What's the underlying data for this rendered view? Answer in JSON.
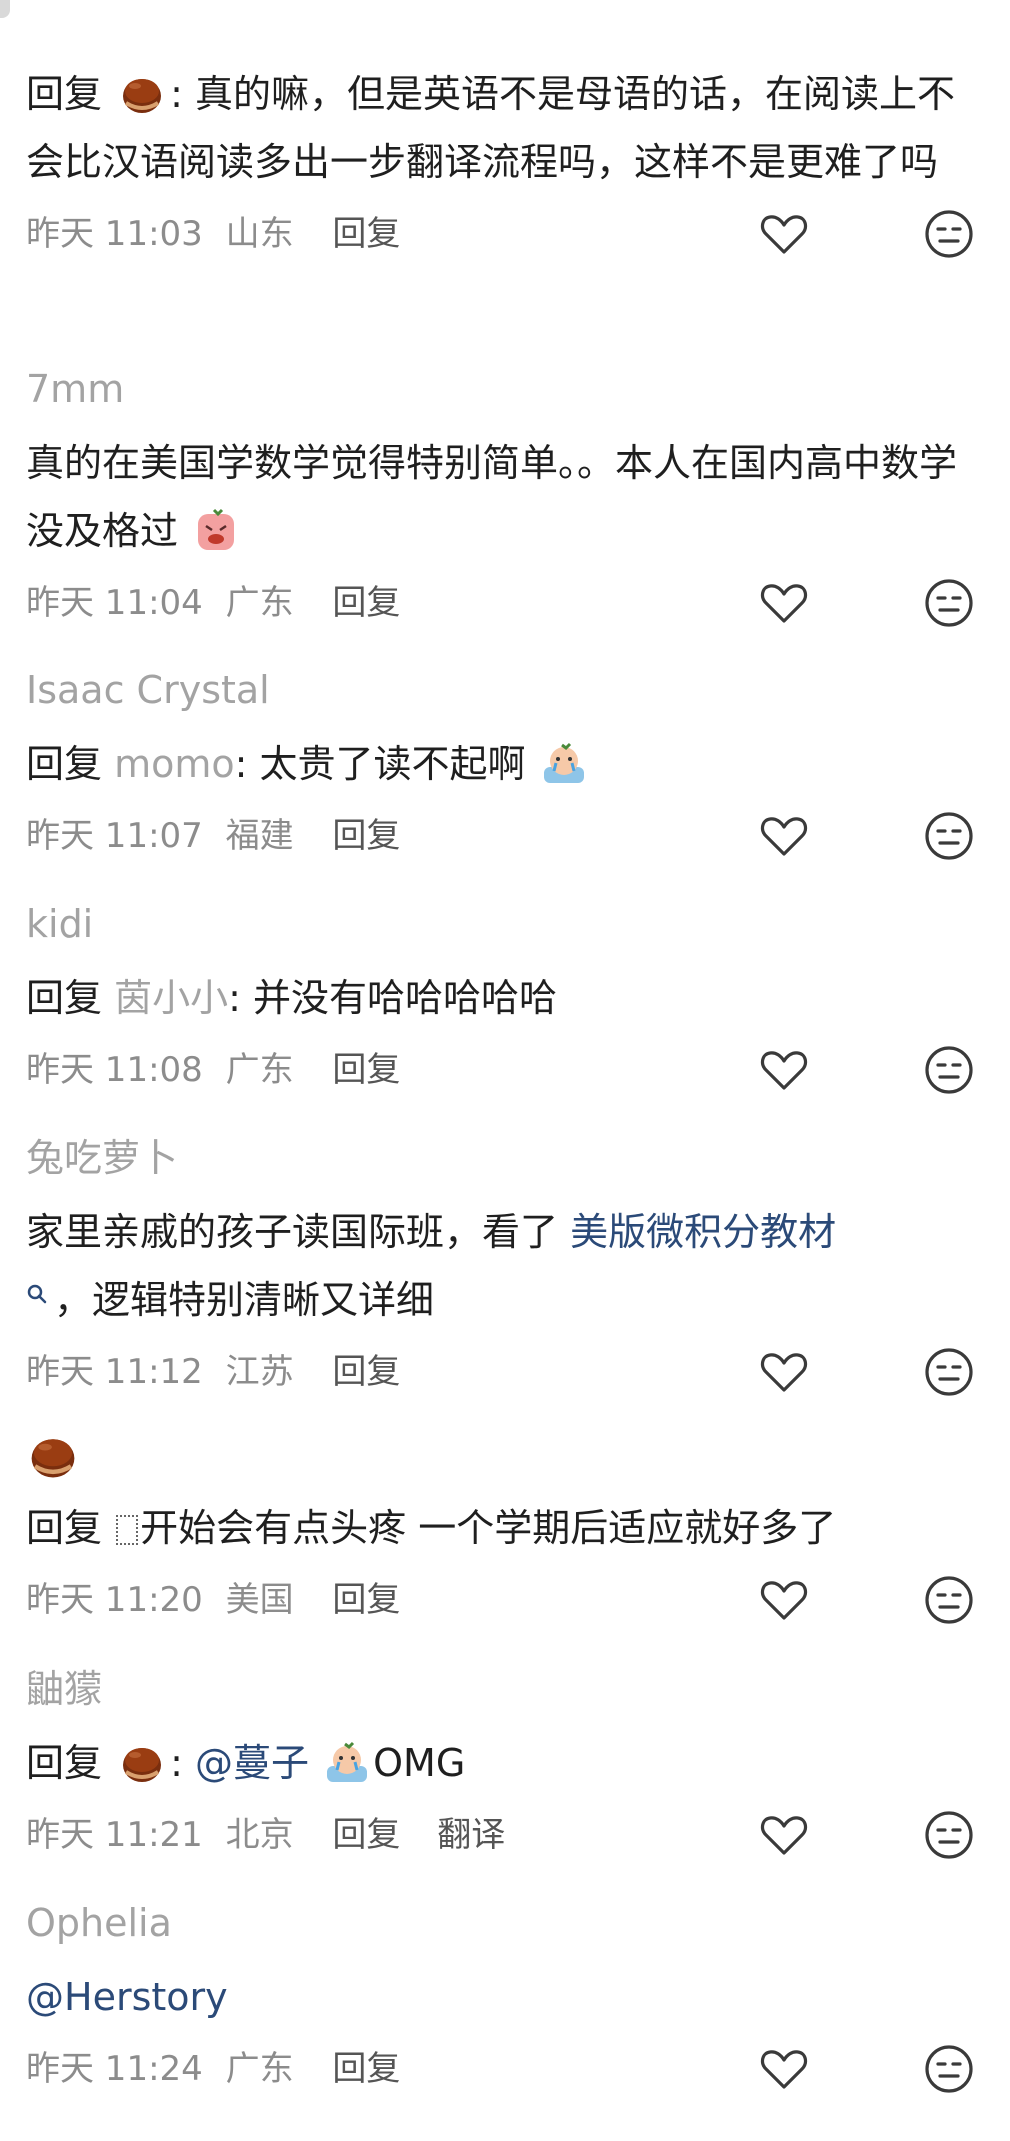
{
  "comments": [
    {
      "username": "",
      "reply_prefix": "回复",
      "reply_target": "",
      "colon": ":",
      "text": " 真的嘛，但是英语不是母语的话，在阅读上不会比汉语阅读多出一步翻译流程吗，这样不是更难了吗",
      "time": "昨天 11:03",
      "location": "山东",
      "reply_label": "回复"
    },
    {
      "username": "7mm",
      "text": "真的在美国学数学觉得特别简单。。本人在国内高中数学没及格过",
      "time": "昨天 11:04",
      "location": "广东",
      "reply_label": "回复"
    },
    {
      "username": "Isaac Crystal",
      "reply_prefix": "回复",
      "reply_target": "momo",
      "colon": ":",
      "text": " 太贵了读不起啊",
      "time": "昨天 11:07",
      "location": "福建",
      "reply_label": "回复"
    },
    {
      "username": "kidi",
      "reply_prefix": "回复",
      "reply_target": "茵小小",
      "colon": ":",
      "text": " 并没有哈哈哈哈哈",
      "time": "昨天 11:08",
      "location": "广东",
      "reply_label": "回复"
    },
    {
      "username": "兔吃萝卜",
      "text_before": "家里亲戚的孩子读国际班，看了 ",
      "link": "美版微积分教材",
      "text_after": "，逻辑特别清晰又详细",
      "time": "昨天 11:12",
      "location": "江苏",
      "reply_label": "回复"
    },
    {
      "username": "",
      "reply_prefix": "回复",
      "text": "开始会有点头疼 一个学期后适应就好多了",
      "time": "昨天 11:20",
      "location": "美国",
      "reply_label": "回复"
    },
    {
      "username": "鼬獴",
      "reply_prefix": "回复",
      "colon": ":",
      "mention": "@蔓子",
      "text": "OMG",
      "time": "昨天 11:21",
      "location": "北京",
      "reply_label": "回复",
      "translate_label": "翻译"
    },
    {
      "username": "Ophelia",
      "mention": "@Herstory",
      "time": "昨天 11:24",
      "location": "广东",
      "reply_label": "回复"
    }
  ],
  "icons": {
    "like": "heart-outline-icon",
    "dislike": "neutral-face-icon"
  },
  "colors": {
    "username": "#a3a3a3",
    "link": "#2b4a78",
    "meta": "#8c8c8c",
    "icon": "#3a3a3a"
  }
}
